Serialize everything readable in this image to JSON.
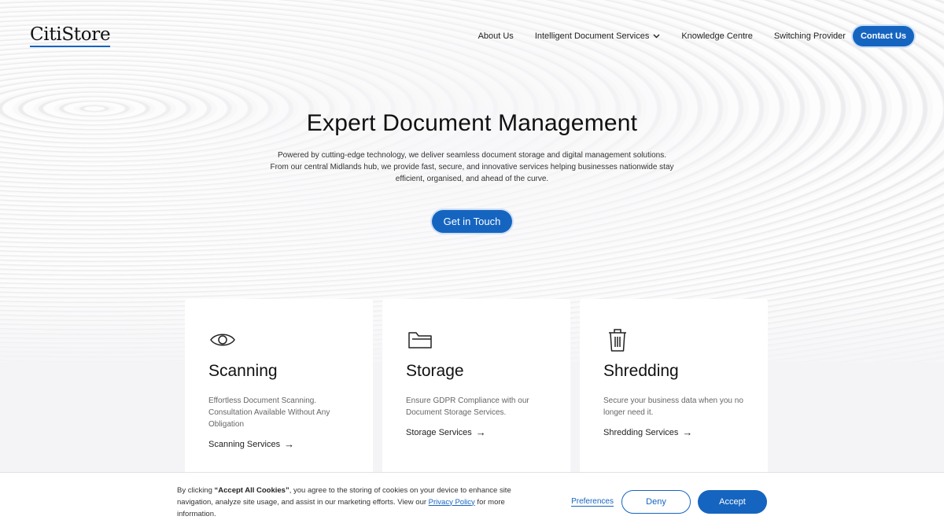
{
  "header": {
    "logo": "CitiStore",
    "nav": {
      "about": "About Us",
      "services": "Intelligent Document Services",
      "knowledge": "Knowledge Centre",
      "switching": "Switching Provider",
      "contact": "Contact Us"
    }
  },
  "hero": {
    "title": "Expert Document Management",
    "body": "Powered by cutting-edge technology, we deliver seamless document storage and digital management solutions. From our central Midlands hub, we provide fast, secure, and innovative services helping businesses nationwide stay efficient, organised, and ahead of the curve.",
    "cta": "Get in Touch"
  },
  "cards": [
    {
      "icon": "eye-icon",
      "title": "Scanning",
      "description": "Effortless Document Scanning. Consultation Available Without Any Obligation",
      "link": "Scanning Services"
    },
    {
      "icon": "folder-icon",
      "title": "Storage",
      "description": "Ensure GDPR Compliance with our Document Storage Services.",
      "link": "Storage Services"
    },
    {
      "icon": "trash-icon",
      "title": "Shredding",
      "description": "Secure your business data when you no longer need it.",
      "link": "Shredding Services"
    }
  ],
  "cookie": {
    "prefix": "By clicking ",
    "bold": "“Accept All Cookies”",
    "middle": ", you agree to the storing of cookies on your device to enhance site navigation, analyze site usage, and assist in our marketing efforts. View our ",
    "privacy_link": "Privacy Policy",
    "suffix": " for more information.",
    "preferences": "Preferences",
    "deny": "Deny",
    "accept": "Accept"
  },
  "colors": {
    "accent": "#1565c0",
    "background": "#f4f4f6"
  }
}
